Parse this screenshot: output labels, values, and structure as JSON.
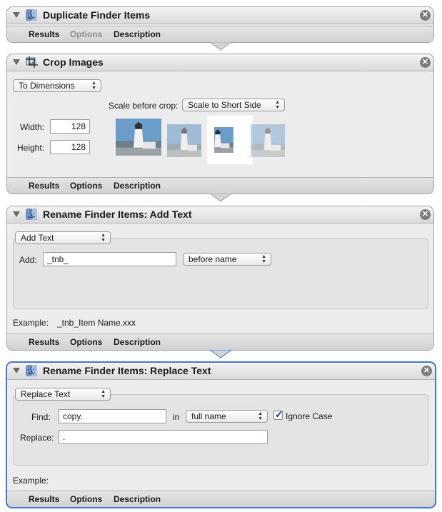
{
  "footer_tabs": {
    "results": "Results",
    "options": "Options",
    "description": "Description"
  },
  "actions": {
    "duplicate": {
      "title": "Duplicate Finder Items",
      "close_glyph": "✕"
    },
    "crop": {
      "title": "Crop Images",
      "close_glyph": "✕",
      "mode_popup": "To Dimensions",
      "scale_label": "Scale before crop:",
      "scale_popup": "Scale to Short Side",
      "width_label": "Width:",
      "width_value": "128",
      "height_label": "Height:",
      "height_value": "128"
    },
    "add_text": {
      "title": "Rename Finder Items: Add Text",
      "close_glyph": "✕",
      "mode_popup": "Add Text",
      "add_label": "Add:",
      "add_value": "_tnb_",
      "position_popup": "before name",
      "example_label": "Example:",
      "example_value": "_tnb_Item Name.xxx"
    },
    "replace_text": {
      "title": "Rename Finder Items: Replace Text",
      "close_glyph": "✕",
      "mode_popup": "Replace Text",
      "find_label": "Find:",
      "find_value": "copy.",
      "in_label": "in",
      "scope_popup": "full name",
      "ignore_case_label": "Ignore Case",
      "ignore_case_checked": true,
      "replace_label": "Replace:",
      "replace_value": ".",
      "example_label": "Example:"
    }
  },
  "colors": {
    "selection_border": "#3d7ad6"
  }
}
